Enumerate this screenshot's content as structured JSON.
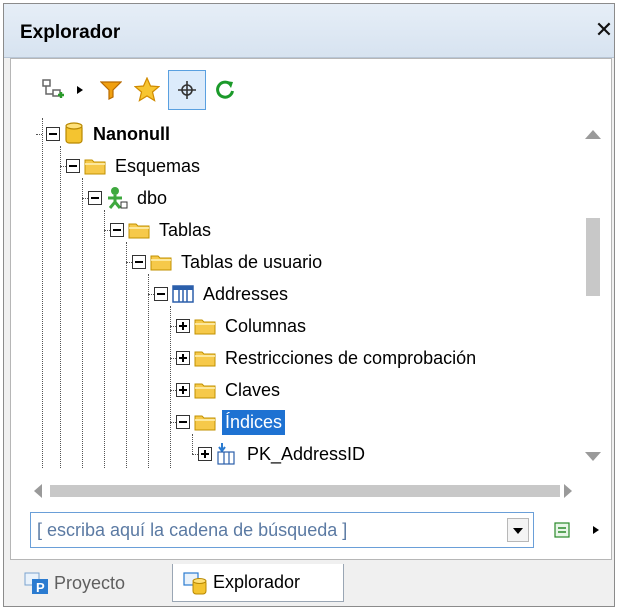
{
  "window": {
    "title": "Explorador",
    "close_label": "✕"
  },
  "toolbar": {
    "items": [
      {
        "name": "add-connection-icon"
      },
      {
        "name": "dropdown-arrow-icon"
      },
      {
        "name": "filter-icon"
      },
      {
        "name": "favorites-star-icon"
      },
      {
        "name": "locate-crosshair-icon",
        "active": true
      },
      {
        "name": "refresh-icon"
      }
    ]
  },
  "tree": {
    "nodes": [
      {
        "label": "Nanonull",
        "icon": "database-icon",
        "toggle": "minus",
        "bold": true
      },
      {
        "label": "Esquemas",
        "icon": "folder-icon",
        "toggle": "minus"
      },
      {
        "label": "dbo",
        "icon": "schema-user-icon",
        "toggle": "minus"
      },
      {
        "label": "Tablas",
        "icon": "folder-icon",
        "toggle": "minus"
      },
      {
        "label": "Tablas de usuario",
        "icon": "folder-icon",
        "toggle": "minus"
      },
      {
        "label": "Addresses",
        "icon": "table-icon",
        "toggle": "minus"
      },
      {
        "label": "Columnas",
        "icon": "folder-icon",
        "toggle": "plus"
      },
      {
        "label": "Restricciones de comprobación",
        "icon": "folder-icon",
        "toggle": "plus"
      },
      {
        "label": "Claves",
        "icon": "folder-icon",
        "toggle": "plus"
      },
      {
        "label": "Índices",
        "icon": "folder-icon",
        "toggle": "minus",
        "selected": true
      },
      {
        "label": "PK_AddressID",
        "icon": "index-icon",
        "toggle": "plus"
      }
    ]
  },
  "search": {
    "placeholder": "[ escriba aquí la cadena de búsqueda ]",
    "value": ""
  },
  "tabs": [
    {
      "label": "Proyecto",
      "active": false
    },
    {
      "label": "Explorador",
      "active": true
    }
  ],
  "colors": {
    "selection": "#1e72d2",
    "folder": "#f6c94a",
    "accent": "#5aa0e0"
  }
}
